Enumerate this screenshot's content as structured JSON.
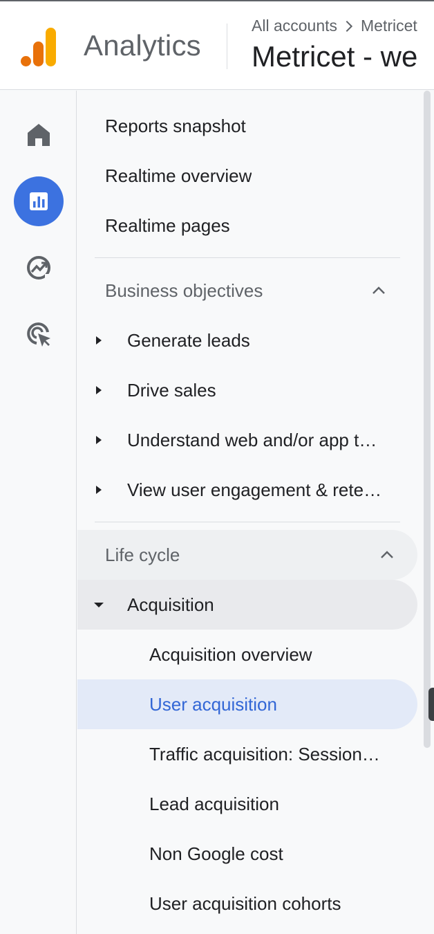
{
  "header": {
    "product_name": "Analytics",
    "breadcrumb": [
      "All accounts",
      "Metricet"
    ],
    "property_title": "Metricet - we"
  },
  "rail": {
    "items": [
      {
        "icon": "home-icon",
        "active": false
      },
      {
        "icon": "reports-icon",
        "active": true
      },
      {
        "icon": "explore-icon",
        "active": false
      },
      {
        "icon": "advertising-icon",
        "active": false
      }
    ]
  },
  "nav": {
    "top_items": [
      "Reports snapshot",
      "Realtime overview",
      "Realtime pages"
    ],
    "business_objectives": {
      "title": "Business objectives",
      "items": [
        "Generate leads",
        "Drive sales",
        "Understand web and/or app traffic",
        "View user engagement & retention"
      ],
      "items_display": [
        "Generate leads",
        "Drive sales",
        "Understand web and/or app t…",
        "View user engagement & rete…"
      ]
    },
    "life_cycle": {
      "title": "Life cycle",
      "acquisition": {
        "title": "Acquisition",
        "items": [
          "Acquisition overview",
          "User acquisition",
          "Traffic acquisition: Session…",
          "Lead acquisition",
          "Non Google cost",
          "User acquisition cohorts"
        ],
        "selected": "User acquisition"
      }
    }
  },
  "colors": {
    "accent_blue": "#3c72e0",
    "selected_text": "#3367d6",
    "selected_bg": "#e3eaf8",
    "logo_orange": "#e8710a",
    "logo_yellow": "#f9ab00"
  }
}
